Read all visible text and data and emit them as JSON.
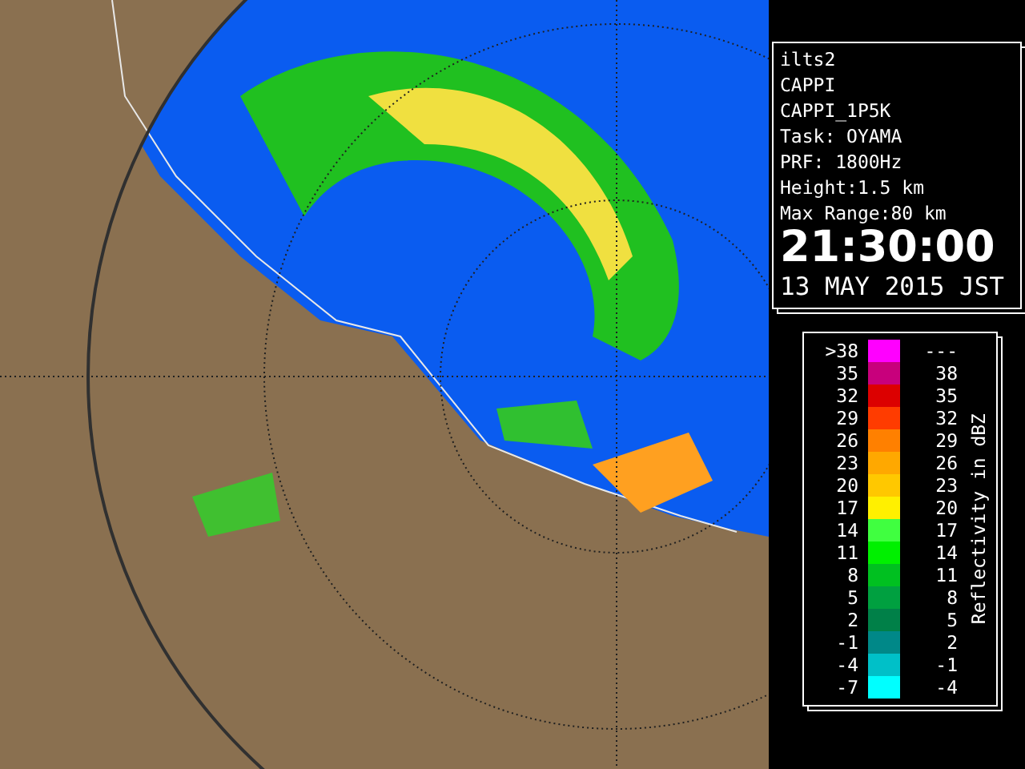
{
  "info_panel": {
    "lines": [
      "ilts2",
      "CAPPI",
      "CAPPI_1P5K",
      "Task: OYAMA",
      "PRF: 1800Hz",
      "Height:1.5 km",
      "Max Range:80 km"
    ],
    "time": "21:30:00",
    "date": "13 MAY 2015 JST"
  },
  "legend": {
    "title": "Reflectivity in dBZ",
    "rows": [
      {
        "low": ">38",
        "high": "---",
        "color": "#ff00ff"
      },
      {
        "low": "35",
        "high": "38",
        "color": "#c8007c"
      },
      {
        "low": "32",
        "high": "35",
        "color": "#dc0000"
      },
      {
        "low": "29",
        "high": "32",
        "color": "#ff3c00"
      },
      {
        "low": "26",
        "high": "29",
        "color": "#ff8000"
      },
      {
        "low": "23",
        "high": "26",
        "color": "#ffa800"
      },
      {
        "low": "20",
        "high": "23",
        "color": "#ffc800"
      },
      {
        "low": "17",
        "high": "20",
        "color": "#fff000"
      },
      {
        "low": "14",
        "high": "17",
        "color": "#40ff40"
      },
      {
        "low": "11",
        "high": "14",
        "color": "#00f000"
      },
      {
        "low": "8",
        "high": "11",
        "color": "#00c020"
      },
      {
        "low": "5",
        "high": "8",
        "color": "#00a040"
      },
      {
        "low": "2",
        "high": "5",
        "color": "#008048"
      },
      {
        "low": "-1",
        "high": "2",
        "color": "#008888"
      },
      {
        "low": "-4",
        "high": "-1",
        "color": "#00c0c8"
      },
      {
        "low": "-7",
        "high": "-4",
        "color": "#00ffff"
      }
    ]
  }
}
